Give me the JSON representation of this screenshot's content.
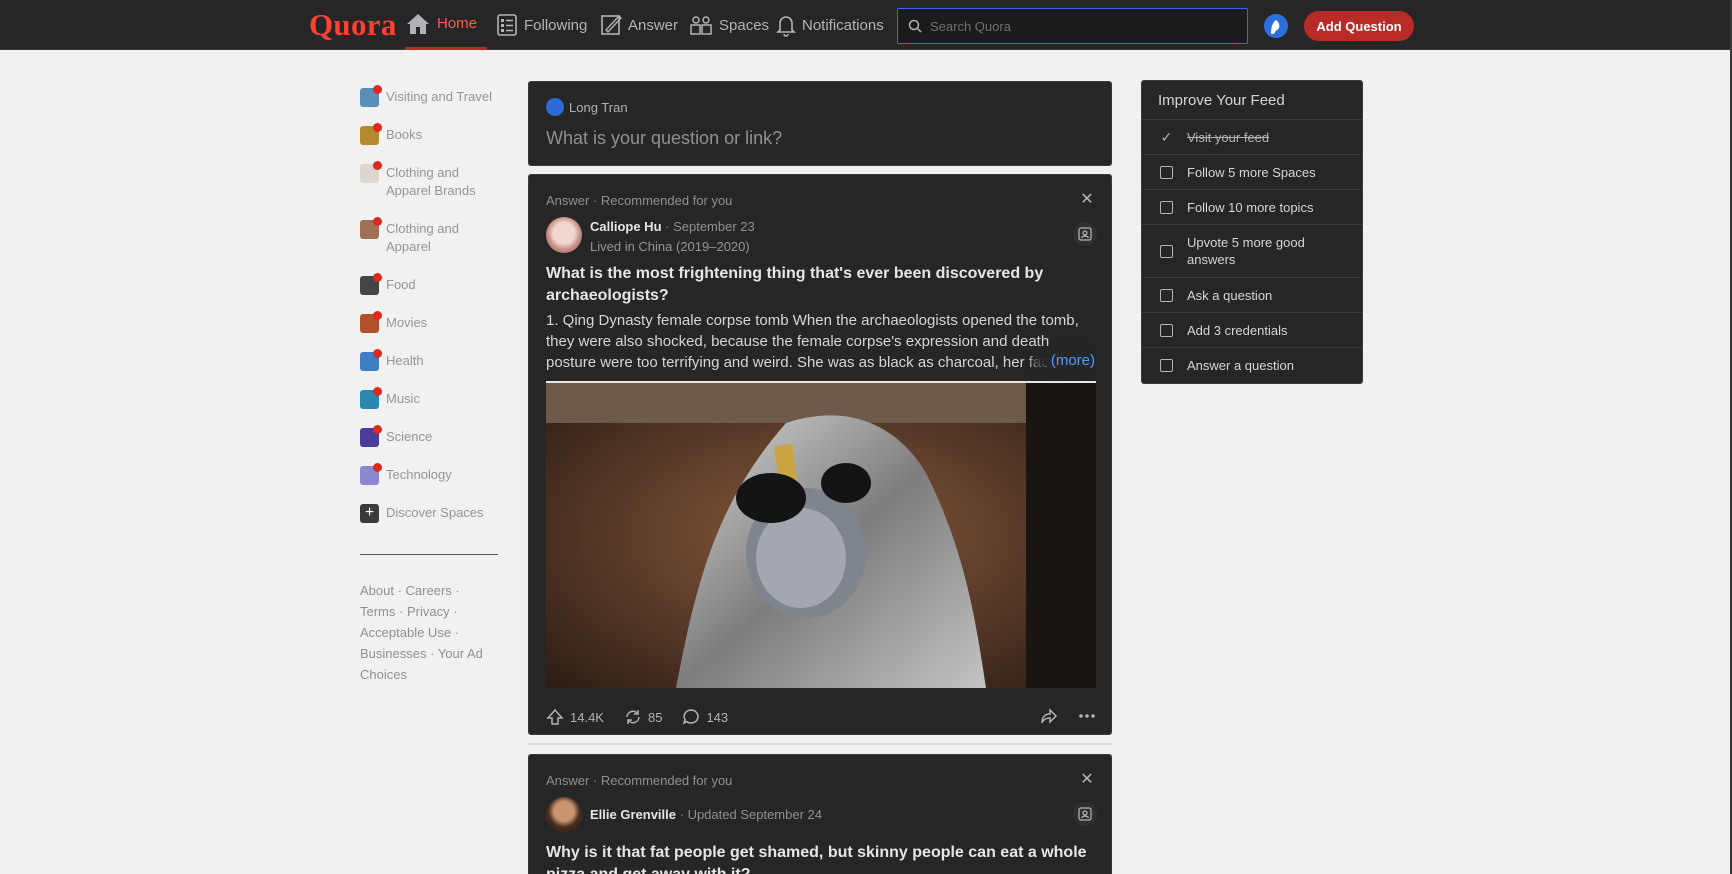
{
  "header": {
    "logo": "Quora",
    "nav": [
      {
        "label": "Home",
        "icon": "home-icon",
        "active": true
      },
      {
        "label": "Following",
        "icon": "following-icon"
      },
      {
        "label": "Answer",
        "icon": "answer-icon"
      },
      {
        "label": "Spaces",
        "icon": "spaces-icon"
      },
      {
        "label": "Notifications",
        "icon": "bell-icon"
      }
    ],
    "search_placeholder": "Search Quora",
    "add_question_label": "Add Question"
  },
  "sidebar": {
    "topics": [
      {
        "label": "Visiting and Travel",
        "color": "#5a8fb8"
      },
      {
        "label": "Books",
        "color": "#b38a2e"
      },
      {
        "label": "Clothing and Apparel Brands",
        "color": "#ddd7d0"
      },
      {
        "label": "Clothing and Apparel",
        "color": "#a06f58"
      },
      {
        "label": "Food",
        "color": "#444444"
      },
      {
        "label": "Movies",
        "color": "#b0512c"
      },
      {
        "label": "Health",
        "color": "#3f7fc4"
      },
      {
        "label": "Music",
        "color": "#2a88b0"
      },
      {
        "label": "Science",
        "color": "#4b3c9a"
      },
      {
        "label": "Technology",
        "color": "#8c88d0"
      }
    ],
    "discover_label": "Discover Spaces",
    "footer_links": [
      "About",
      "Careers",
      "Terms",
      "Privacy",
      "Acceptable Use",
      "Businesses",
      "Your Ad Choices"
    ]
  },
  "ask_box": {
    "user_name": "Long Tran",
    "prompt": "What is your question or link?"
  },
  "posts": [
    {
      "meta": "Answer · Recommended for you",
      "author": "Calliope Hu",
      "date": "· September 23",
      "credential": "Lived in China (2019–2020)",
      "question": "What is the most frightening thing that's ever been discovered by archaeologists?",
      "excerpt": "1. Qing Dynasty female corpse tomb When the archaeologists opened the tomb, they were also shocked, because the female corpse's expression and death posture were too terrifying and weird. She was as black as charcoal, her facial expression",
      "more": "(more)",
      "upvotes": "14.4K",
      "shares": "85",
      "comments": "143"
    },
    {
      "meta": "Answer · Recommended for you",
      "author": "Ellie Grenville",
      "date": "· Updated September 24",
      "question": "Why is it that fat people get shamed, but skinny people can eat a whole pizza and get away with it?"
    }
  ],
  "improve_feed": {
    "title": "Improve Your Feed",
    "tasks": [
      {
        "label": "Visit your feed",
        "done": true
      },
      {
        "label": "Follow 5 more Spaces",
        "done": false
      },
      {
        "label": "Follow 10 more topics",
        "done": false
      },
      {
        "label": "Upvote 5 more good answers",
        "done": false
      },
      {
        "label": "Ask a question",
        "done": false
      },
      {
        "label": "Add 3 credentials",
        "done": false
      },
      {
        "label": "Answer a question",
        "done": false
      }
    ]
  },
  "colors": {
    "brand": "#b92b27",
    "logo": "#ff3f2f",
    "link": "#4d9cff",
    "header_bg": "#262626",
    "page_bg": "#f1f1f2"
  }
}
